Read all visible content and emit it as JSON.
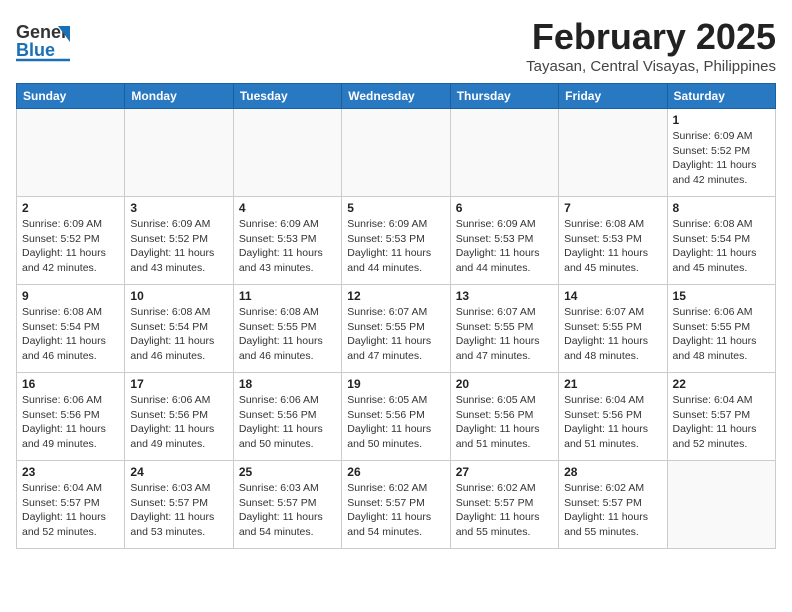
{
  "header": {
    "logo_general": "General",
    "logo_blue": "Blue",
    "title": "February 2025",
    "subtitle": "Tayasan, Central Visayas, Philippines"
  },
  "weekdays": [
    "Sunday",
    "Monday",
    "Tuesday",
    "Wednesday",
    "Thursday",
    "Friday",
    "Saturday"
  ],
  "weeks": [
    [
      {
        "day": "",
        "detail": ""
      },
      {
        "day": "",
        "detail": ""
      },
      {
        "day": "",
        "detail": ""
      },
      {
        "day": "",
        "detail": ""
      },
      {
        "day": "",
        "detail": ""
      },
      {
        "day": "",
        "detail": ""
      },
      {
        "day": "1",
        "detail": "Sunrise: 6:09 AM\nSunset: 5:52 PM\nDaylight: 11 hours\nand 42 minutes."
      }
    ],
    [
      {
        "day": "2",
        "detail": "Sunrise: 6:09 AM\nSunset: 5:52 PM\nDaylight: 11 hours\nand 42 minutes."
      },
      {
        "day": "3",
        "detail": "Sunrise: 6:09 AM\nSunset: 5:52 PM\nDaylight: 11 hours\nand 43 minutes."
      },
      {
        "day": "4",
        "detail": "Sunrise: 6:09 AM\nSunset: 5:53 PM\nDaylight: 11 hours\nand 43 minutes."
      },
      {
        "day": "5",
        "detail": "Sunrise: 6:09 AM\nSunset: 5:53 PM\nDaylight: 11 hours\nand 44 minutes."
      },
      {
        "day": "6",
        "detail": "Sunrise: 6:09 AM\nSunset: 5:53 PM\nDaylight: 11 hours\nand 44 minutes."
      },
      {
        "day": "7",
        "detail": "Sunrise: 6:08 AM\nSunset: 5:53 PM\nDaylight: 11 hours\nand 45 minutes."
      },
      {
        "day": "8",
        "detail": "Sunrise: 6:08 AM\nSunset: 5:54 PM\nDaylight: 11 hours\nand 45 minutes."
      }
    ],
    [
      {
        "day": "9",
        "detail": "Sunrise: 6:08 AM\nSunset: 5:54 PM\nDaylight: 11 hours\nand 46 minutes."
      },
      {
        "day": "10",
        "detail": "Sunrise: 6:08 AM\nSunset: 5:54 PM\nDaylight: 11 hours\nand 46 minutes."
      },
      {
        "day": "11",
        "detail": "Sunrise: 6:08 AM\nSunset: 5:55 PM\nDaylight: 11 hours\nand 46 minutes."
      },
      {
        "day": "12",
        "detail": "Sunrise: 6:07 AM\nSunset: 5:55 PM\nDaylight: 11 hours\nand 47 minutes."
      },
      {
        "day": "13",
        "detail": "Sunrise: 6:07 AM\nSunset: 5:55 PM\nDaylight: 11 hours\nand 47 minutes."
      },
      {
        "day": "14",
        "detail": "Sunrise: 6:07 AM\nSunset: 5:55 PM\nDaylight: 11 hours\nand 48 minutes."
      },
      {
        "day": "15",
        "detail": "Sunrise: 6:06 AM\nSunset: 5:55 PM\nDaylight: 11 hours\nand 48 minutes."
      }
    ],
    [
      {
        "day": "16",
        "detail": "Sunrise: 6:06 AM\nSunset: 5:56 PM\nDaylight: 11 hours\nand 49 minutes."
      },
      {
        "day": "17",
        "detail": "Sunrise: 6:06 AM\nSunset: 5:56 PM\nDaylight: 11 hours\nand 49 minutes."
      },
      {
        "day": "18",
        "detail": "Sunrise: 6:06 AM\nSunset: 5:56 PM\nDaylight: 11 hours\nand 50 minutes."
      },
      {
        "day": "19",
        "detail": "Sunrise: 6:05 AM\nSunset: 5:56 PM\nDaylight: 11 hours\nand 50 minutes."
      },
      {
        "day": "20",
        "detail": "Sunrise: 6:05 AM\nSunset: 5:56 PM\nDaylight: 11 hours\nand 51 minutes."
      },
      {
        "day": "21",
        "detail": "Sunrise: 6:04 AM\nSunset: 5:56 PM\nDaylight: 11 hours\nand 51 minutes."
      },
      {
        "day": "22",
        "detail": "Sunrise: 6:04 AM\nSunset: 5:57 PM\nDaylight: 11 hours\nand 52 minutes."
      }
    ],
    [
      {
        "day": "23",
        "detail": "Sunrise: 6:04 AM\nSunset: 5:57 PM\nDaylight: 11 hours\nand 52 minutes."
      },
      {
        "day": "24",
        "detail": "Sunrise: 6:03 AM\nSunset: 5:57 PM\nDaylight: 11 hours\nand 53 minutes."
      },
      {
        "day": "25",
        "detail": "Sunrise: 6:03 AM\nSunset: 5:57 PM\nDaylight: 11 hours\nand 54 minutes."
      },
      {
        "day": "26",
        "detail": "Sunrise: 6:02 AM\nSunset: 5:57 PM\nDaylight: 11 hours\nand 54 minutes."
      },
      {
        "day": "27",
        "detail": "Sunrise: 6:02 AM\nSunset: 5:57 PM\nDaylight: 11 hours\nand 55 minutes."
      },
      {
        "day": "28",
        "detail": "Sunrise: 6:02 AM\nSunset: 5:57 PM\nDaylight: 11 hours\nand 55 minutes."
      },
      {
        "day": "",
        "detail": ""
      }
    ]
  ]
}
